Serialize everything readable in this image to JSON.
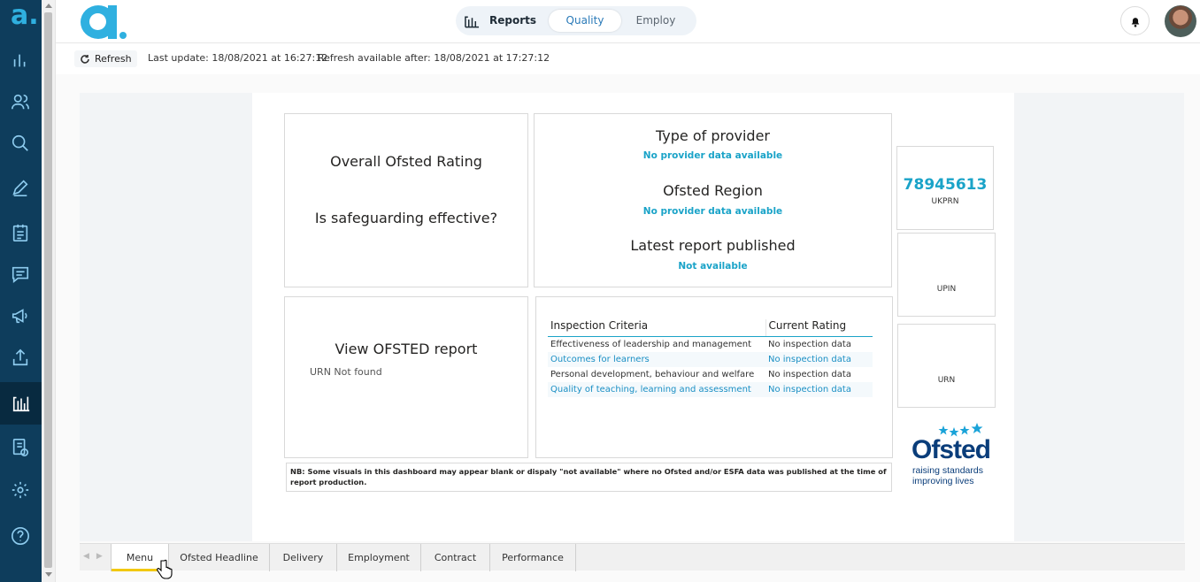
{
  "topbar": {
    "tabs": [
      {
        "label": "Reports"
      },
      {
        "label": "Quality"
      },
      {
        "label": "Employ"
      }
    ]
  },
  "subbar": {
    "refresh_label": "Refresh",
    "last_update": "Last update: 18/08/2021 at 16:27:12",
    "refresh_available": "Refresh available after: 18/08/2021 at 17:27:12"
  },
  "report": {
    "overall_rating_title": "Overall Ofsted Rating",
    "safeguarding_title": "Is safeguarding effective?",
    "provider_type_title": "Type of provider",
    "provider_type_value": "No provider data available",
    "region_title": "Ofsted Region",
    "region_value": "No provider data available",
    "latest_report_title": "Latest report published",
    "latest_report_value": "Not available",
    "ukprn_value": "78945613",
    "ukprn_label": "UKPRN",
    "upin_label": "UPIN",
    "urn_label": "URN",
    "view_report_title": "View OFSTED report",
    "urn_not_found": "URN Not found",
    "criteria_table": {
      "headers": [
        "Inspection Criteria",
        "Current Rating"
      ],
      "rows": [
        [
          "Effectiveness of leadership and management",
          "No inspection data"
        ],
        [
          "Outcomes for learners",
          "No inspection data"
        ],
        [
          "Personal development, behaviour and welfare",
          "No inspection data"
        ],
        [
          "Quality of teaching, learning and assessment",
          "No inspection data"
        ]
      ]
    },
    "note": "NB: Some visuals in this dashboard may appear blank or dispaly \"not available\" where no Ofsted and/or ESFA data was published at the time of report production.",
    "ofsted_logo_word": "Ofsted",
    "ofsted_logo_tag1": "raising standards",
    "ofsted_logo_tag2": "improving lives"
  },
  "page_tabs": [
    "Menu",
    "Ofsted Headline",
    "Delivery",
    "Employment",
    "Contract",
    "Performance"
  ],
  "colors": {
    "sidebar": "#0e3d5c",
    "accent": "#2fb0e0",
    "value_text": "#1aa3c8",
    "tab_highlight": "#f2c811"
  }
}
